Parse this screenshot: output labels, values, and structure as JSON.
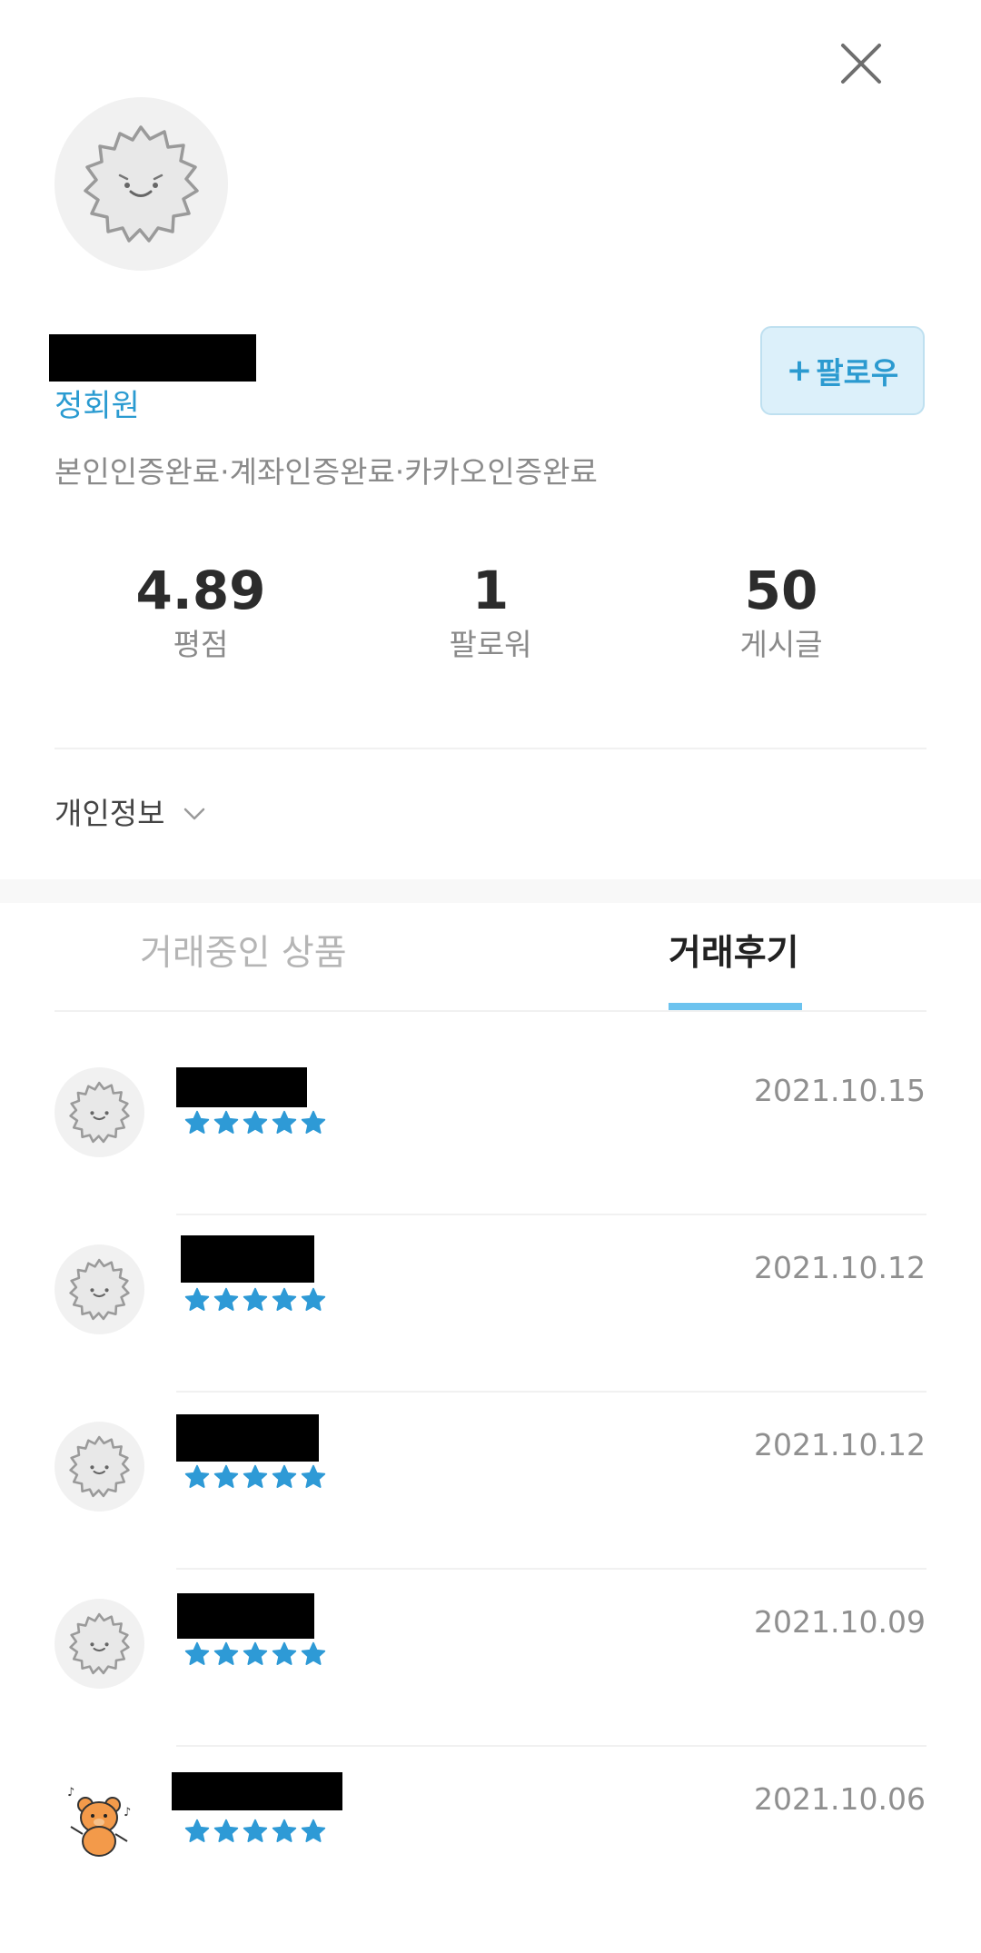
{
  "header": {
    "close_icon": "close-icon"
  },
  "profile": {
    "grade": "정회원",
    "verifications": "본인인증완료·계좌인증완료·카카오인증완료",
    "follow_button": {
      "plus": "+",
      "label": "팔로우"
    },
    "stats": [
      {
        "value": "4.89",
        "label": "평점"
      },
      {
        "value": "1",
        "label": "팔로워"
      },
      {
        "value": "50",
        "label": "게시글"
      }
    ],
    "privacy_label": "개인정보"
  },
  "tabs": [
    {
      "label": "거래중인 상품",
      "selected": false
    },
    {
      "label": "거래후기",
      "selected": true
    }
  ],
  "reviews": [
    {
      "date": "2021.10.15",
      "stars": 5,
      "avatar": "fluffy-character"
    },
    {
      "date": "2021.10.12",
      "stars": 5,
      "avatar": "fluffy-character"
    },
    {
      "date": "2021.10.12",
      "stars": 5,
      "avatar": "fluffy-character"
    },
    {
      "date": "2021.10.09",
      "stars": 5,
      "avatar": "fluffy-character"
    },
    {
      "date": "2021.10.06",
      "stars": 5,
      "avatar": "dancing-bear"
    }
  ],
  "colors": {
    "accent": "#2b9ad0",
    "star": "#2e9ad6",
    "tab_indicator": "#6cc3ef",
    "follow_bg": "#dcf0fa"
  }
}
